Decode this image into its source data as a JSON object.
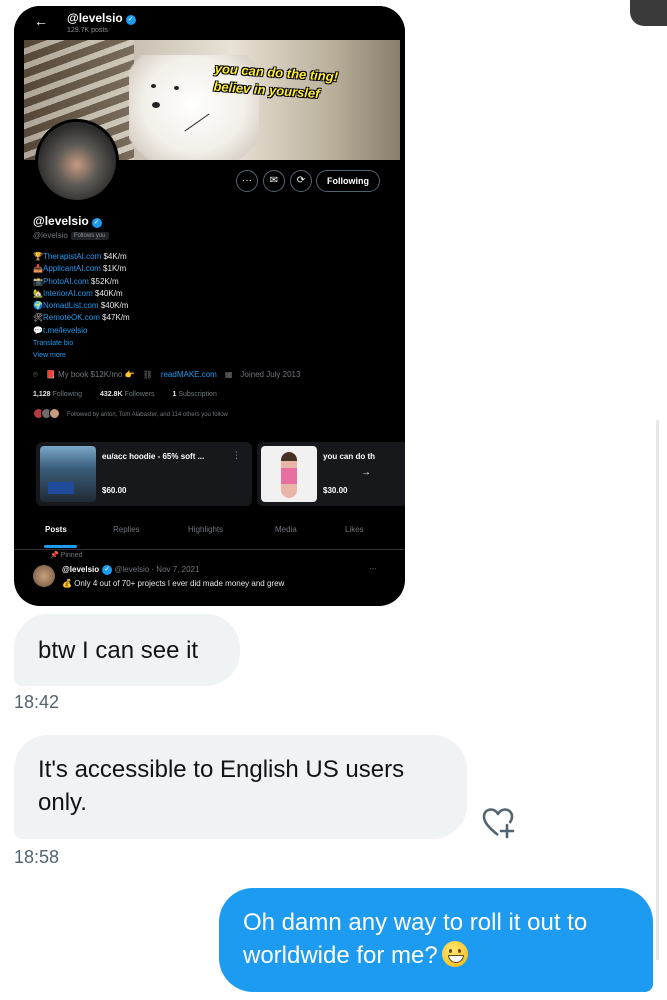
{
  "profile_screenshot": {
    "header": {
      "back_icon": "arrow-left-icon",
      "name": "@levelsio",
      "posts_count": "129.7K posts"
    },
    "banner_text": [
      "you can do the ting!",
      "believ in yourslef"
    ],
    "actions": {
      "more_icon": "more-icon",
      "message_icon": "envelope-icon",
      "subscribe_icon": "subscribe-icon",
      "following_label": "Following"
    },
    "name": "@levelsio",
    "handle": "@levelsio",
    "follows_you": "Follows you",
    "bio": [
      {
        "emoji": "🏆",
        "link": "TherapistAI.com",
        "value": "$4K/m"
      },
      {
        "emoji": "📥",
        "link": "ApplicantAI.com",
        "value": "$1K/m"
      },
      {
        "emoji": "📸",
        "link": "PhotoAI.com",
        "value": "$52K/m"
      },
      {
        "emoji": "🏡",
        "link": "InteriorAI.com",
        "value": "$40K/m"
      },
      {
        "emoji": "🌍",
        "link": "NomadList.com",
        "value": "$40K/m"
      },
      {
        "emoji": "🛠",
        "link": "RemoteOK.com",
        "value": "$47K/m"
      },
      {
        "emoji": "💬",
        "link": "t.me/levelsio",
        "value": ""
      }
    ],
    "translate_bio": "Translate bio",
    "view_more": "View more",
    "meta": {
      "book": "📕 My book $12K/mo 👉",
      "website": "readMAKE.com",
      "joined": "Joined July 2013"
    },
    "stats": {
      "following_count": "1,128",
      "following_label": "Following",
      "followers_count": "432.8K",
      "followers_label": "Followers",
      "subscription_count": "1",
      "subscription_label": "Subscription"
    },
    "followed_by": "Followed by anton, Tom Alabaster, and 114 others you follow",
    "shop": [
      {
        "title": "eu/acc hoodie - 65% soft ...",
        "price": "$60.00"
      },
      {
        "title": "you can do th",
        "price": "$30.00"
      }
    ],
    "tabs": [
      "Posts",
      "Replies",
      "Highlights",
      "Media",
      "Likes"
    ],
    "pinned_label": "Pinned",
    "pinned_post": {
      "name": "@levelsio",
      "handle_date": "@levelsio · Nov 7, 2021",
      "text": "💰 Only 4 out of 70+ projects I ever did made money and grew"
    }
  },
  "messages": [
    {
      "direction": "incoming",
      "text": "btw I can see it",
      "time": "18:42"
    },
    {
      "direction": "incoming",
      "text": "It's accessible to English US users only.",
      "time": "18:58"
    },
    {
      "direction": "outgoing",
      "text": "Oh damn any way to roll it out to worldwide for me?",
      "emoji_icon": "grinning-face-icon"
    }
  ],
  "colors": {
    "accent": "#1d9bf0",
    "incoming_bubble": "#eff3f4",
    "dark_bg": "#000000"
  }
}
